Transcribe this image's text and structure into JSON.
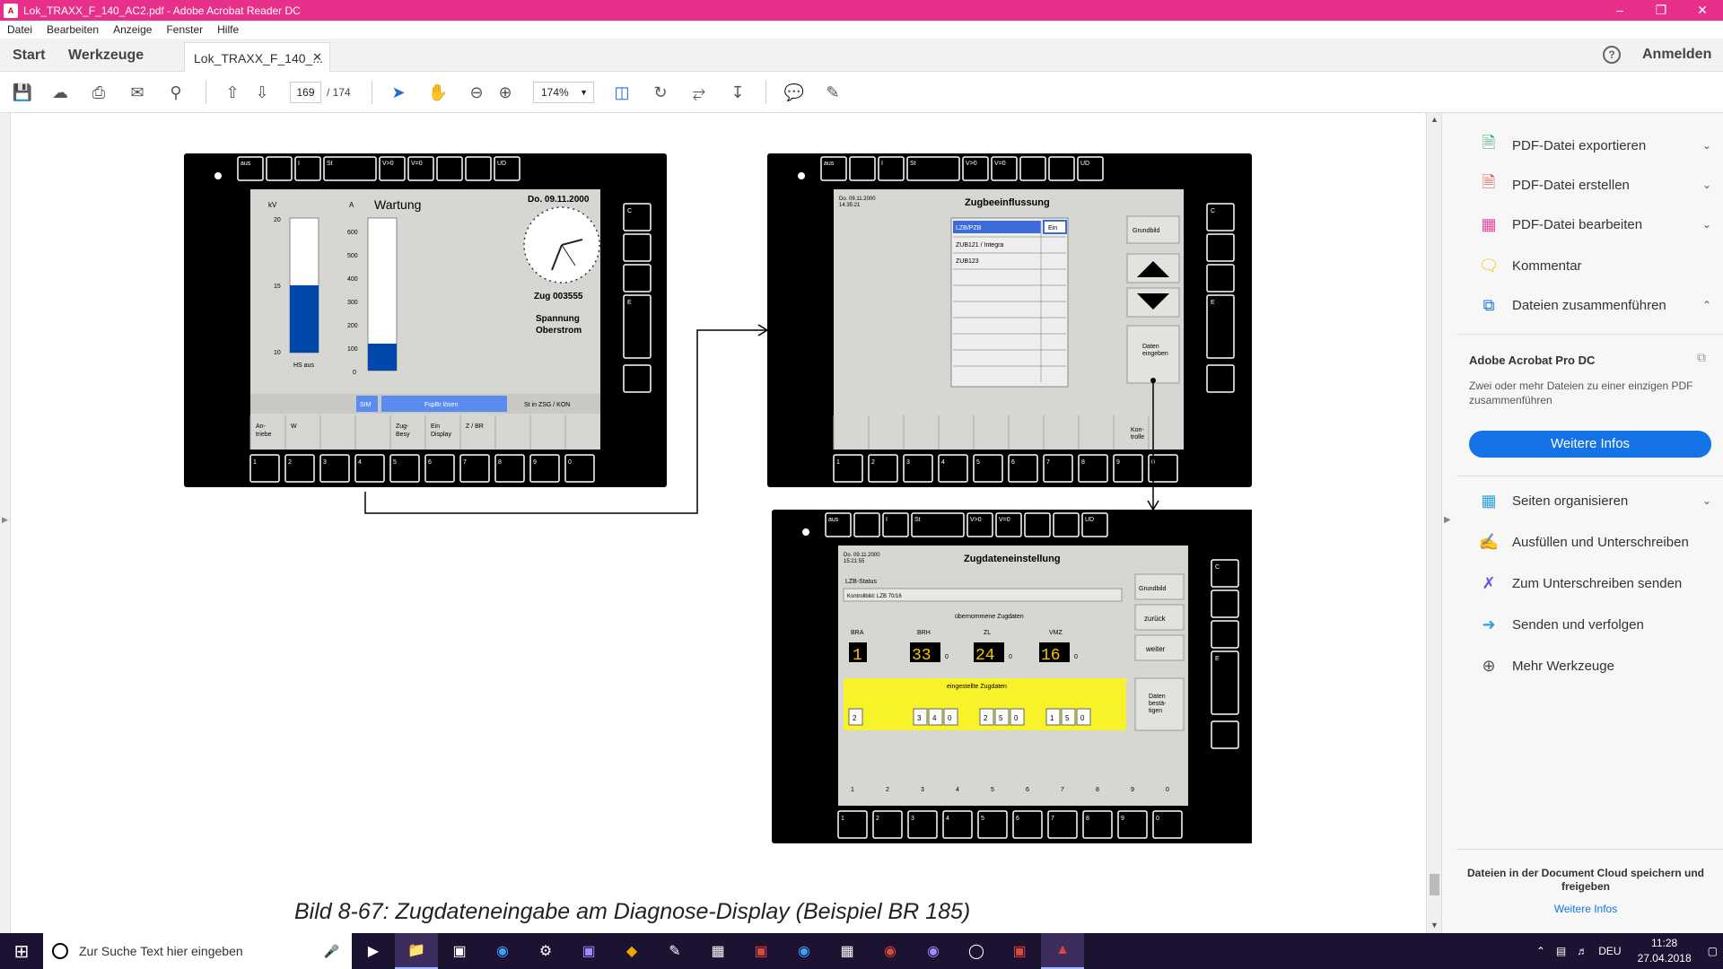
{
  "window": {
    "title": "Lok_TRAXX_F_140_AC2.pdf - Adobe Acrobat Reader DC"
  },
  "menu": [
    "Datei",
    "Bearbeiten",
    "Anzeige",
    "Fenster",
    "Hilfe"
  ],
  "tabs": {
    "start": "Start",
    "tools": "Werkzeuge",
    "document": "Lok_TRAXX_F_140_...",
    "signin": "Anmelden"
  },
  "toolbar": {
    "page_current": "169",
    "page_total": "/ 174",
    "zoom": "174%"
  },
  "right_panel": {
    "items_top": [
      "PDF-Datei exportieren",
      "PDF-Datei erstellen",
      "PDF-Datei bearbeiten",
      "Kommentar",
      "Dateien zusammenführen"
    ],
    "promo_title": "Adobe Acrobat Pro DC",
    "promo_text": "Zwei oder mehr Dateien zu einer einzigen PDF zusammenführen",
    "promo_button": "Weitere Infos",
    "items_bottom": [
      "Seiten organisieren",
      "Ausfüllen und Unterschreiben",
      "Zum Unterschreiben senden",
      "Senden und verfolgen",
      "Mehr Werkzeuge"
    ],
    "footer_text": "Dateien in der Document Cloud speichern und freigeben",
    "footer_link": "Weitere Infos"
  },
  "document": {
    "caption": "Bild 8-67: Zugdateneingabe am Diagnose-Display (Beispiel BR 185)",
    "topbar_keys": [
      "aus",
      "",
      "I",
      "St",
      "V>0",
      "V=0",
      "",
      "",
      "UD"
    ],
    "side_keys": [
      "C",
      "",
      "",
      "E",
      ""
    ],
    "number_keys": [
      "1",
      "2",
      "3",
      "4",
      "5",
      "6",
      "7",
      "8",
      "9",
      "0"
    ],
    "screen1": {
      "kv_label": "kV",
      "a_label": "A",
      "kv_ticks": [
        "20",
        "15",
        "10"
      ],
      "a_ticks": [
        "600",
        "500",
        "400",
        "300",
        "200",
        "100",
        "0"
      ],
      "hs": "HS aus",
      "wartung": "Wartung",
      "date": "Do. 09.11.2000",
      "zug": "Zug 003555",
      "spannung": "Spannung",
      "oberstrom": "Oberstrom",
      "sim": "SIM",
      "fspbr": "FspBr lösen",
      "st_zsg": "St in ZSG / KON",
      "softkeys": [
        "An-\ntriebe",
        "W",
        "",
        "",
        "Zug-\nBesy",
        "Ein\nDisplay",
        "Z / BR",
        "",
        "",
        ""
      ]
    },
    "screen2": {
      "datetime": "Do. 09.11.2000\n14:35:21",
      "title": "Zugbeeinflussung",
      "rows": [
        "LZB/PZB",
        "ZUB121 / Integra",
        "ZUB123"
      ],
      "ein": "Ein",
      "grundbild": "Grundbild",
      "daten_eingeben": "Daten\neingeben",
      "kontrolle": "Kon-\ntrolle"
    },
    "screen3": {
      "datetime": "Do. 09.11.2000\n15:21:55",
      "title": "Zugdateneinstellung",
      "lzb_status": "LZB-Status",
      "kontrollbild": "Kontrollbild: LZB 70/16",
      "uebernommene": "übernommene Zugdaten",
      "cols": [
        "BRA",
        "BRH",
        "ZL",
        "VMZ"
      ],
      "seg_values": [
        "1",
        "33",
        "24",
        "16"
      ],
      "eingestellte": "eingestellte Zugdaten",
      "set_values": [
        "2",
        "3",
        "4",
        "0",
        "2",
        "5",
        "0",
        "1",
        "5",
        "0"
      ],
      "grundbild": "Grundbild",
      "zurueck": "zurück",
      "weiter": "weiter",
      "bestaetigen": "Daten\nbestä-\ntigen"
    }
  },
  "taskbar": {
    "search_placeholder": "Zur Suche Text hier eingeben",
    "lang": "DEU",
    "time": "11:28",
    "date": "27.04.2018"
  }
}
